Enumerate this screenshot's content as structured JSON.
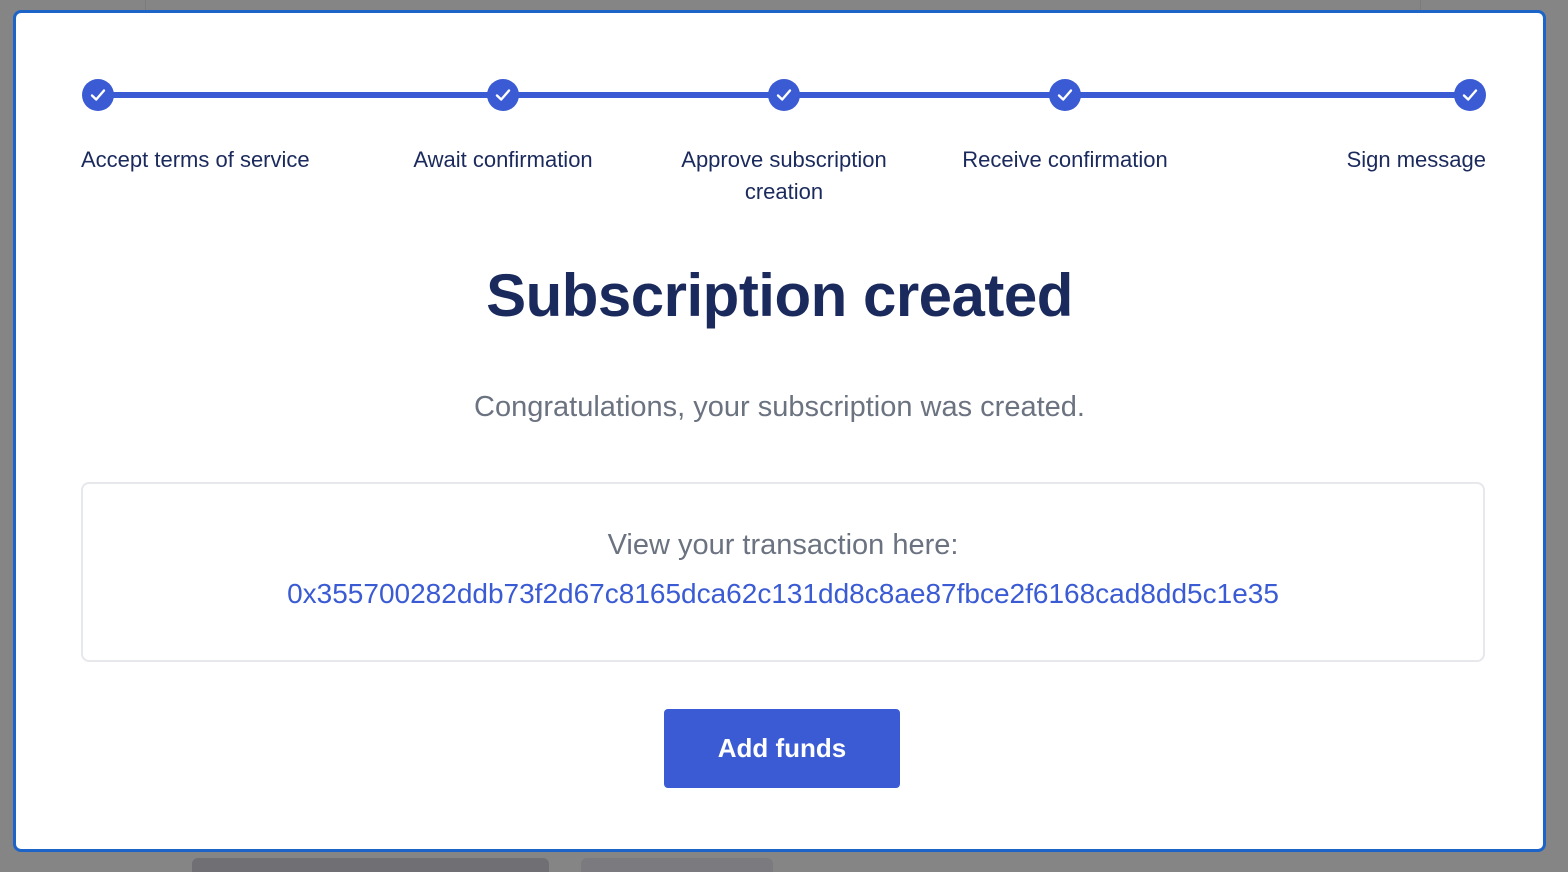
{
  "stepper": {
    "steps": [
      {
        "label": "Accept terms of service",
        "icon": "check-icon",
        "state": "completed"
      },
      {
        "label": "Await confirmation",
        "icon": "check-icon",
        "state": "completed"
      },
      {
        "label_line1": "Approve subscription",
        "label_line2": "creation",
        "icon": "check-icon",
        "state": "completed"
      },
      {
        "label": "Receive confirmation",
        "icon": "check-icon",
        "state": "completed"
      },
      {
        "label": "Sign message",
        "icon": "check-icon",
        "state": "completed"
      }
    ]
  },
  "main": {
    "title": "Subscription created",
    "subtitle": "Congratulations, your subscription was created."
  },
  "transaction": {
    "label": "View your transaction here:",
    "hash": "0x355700282ddb73f2d67c8165dca62c131dd8c8ae87fbce2f6168cad8dd5c1e35"
  },
  "actions": {
    "add_funds_label": "Add funds"
  },
  "colors": {
    "accent": "#3a5bd3",
    "title": "#1b2a5c",
    "muted": "#6b7280",
    "modal_border": "#1d64c8"
  }
}
